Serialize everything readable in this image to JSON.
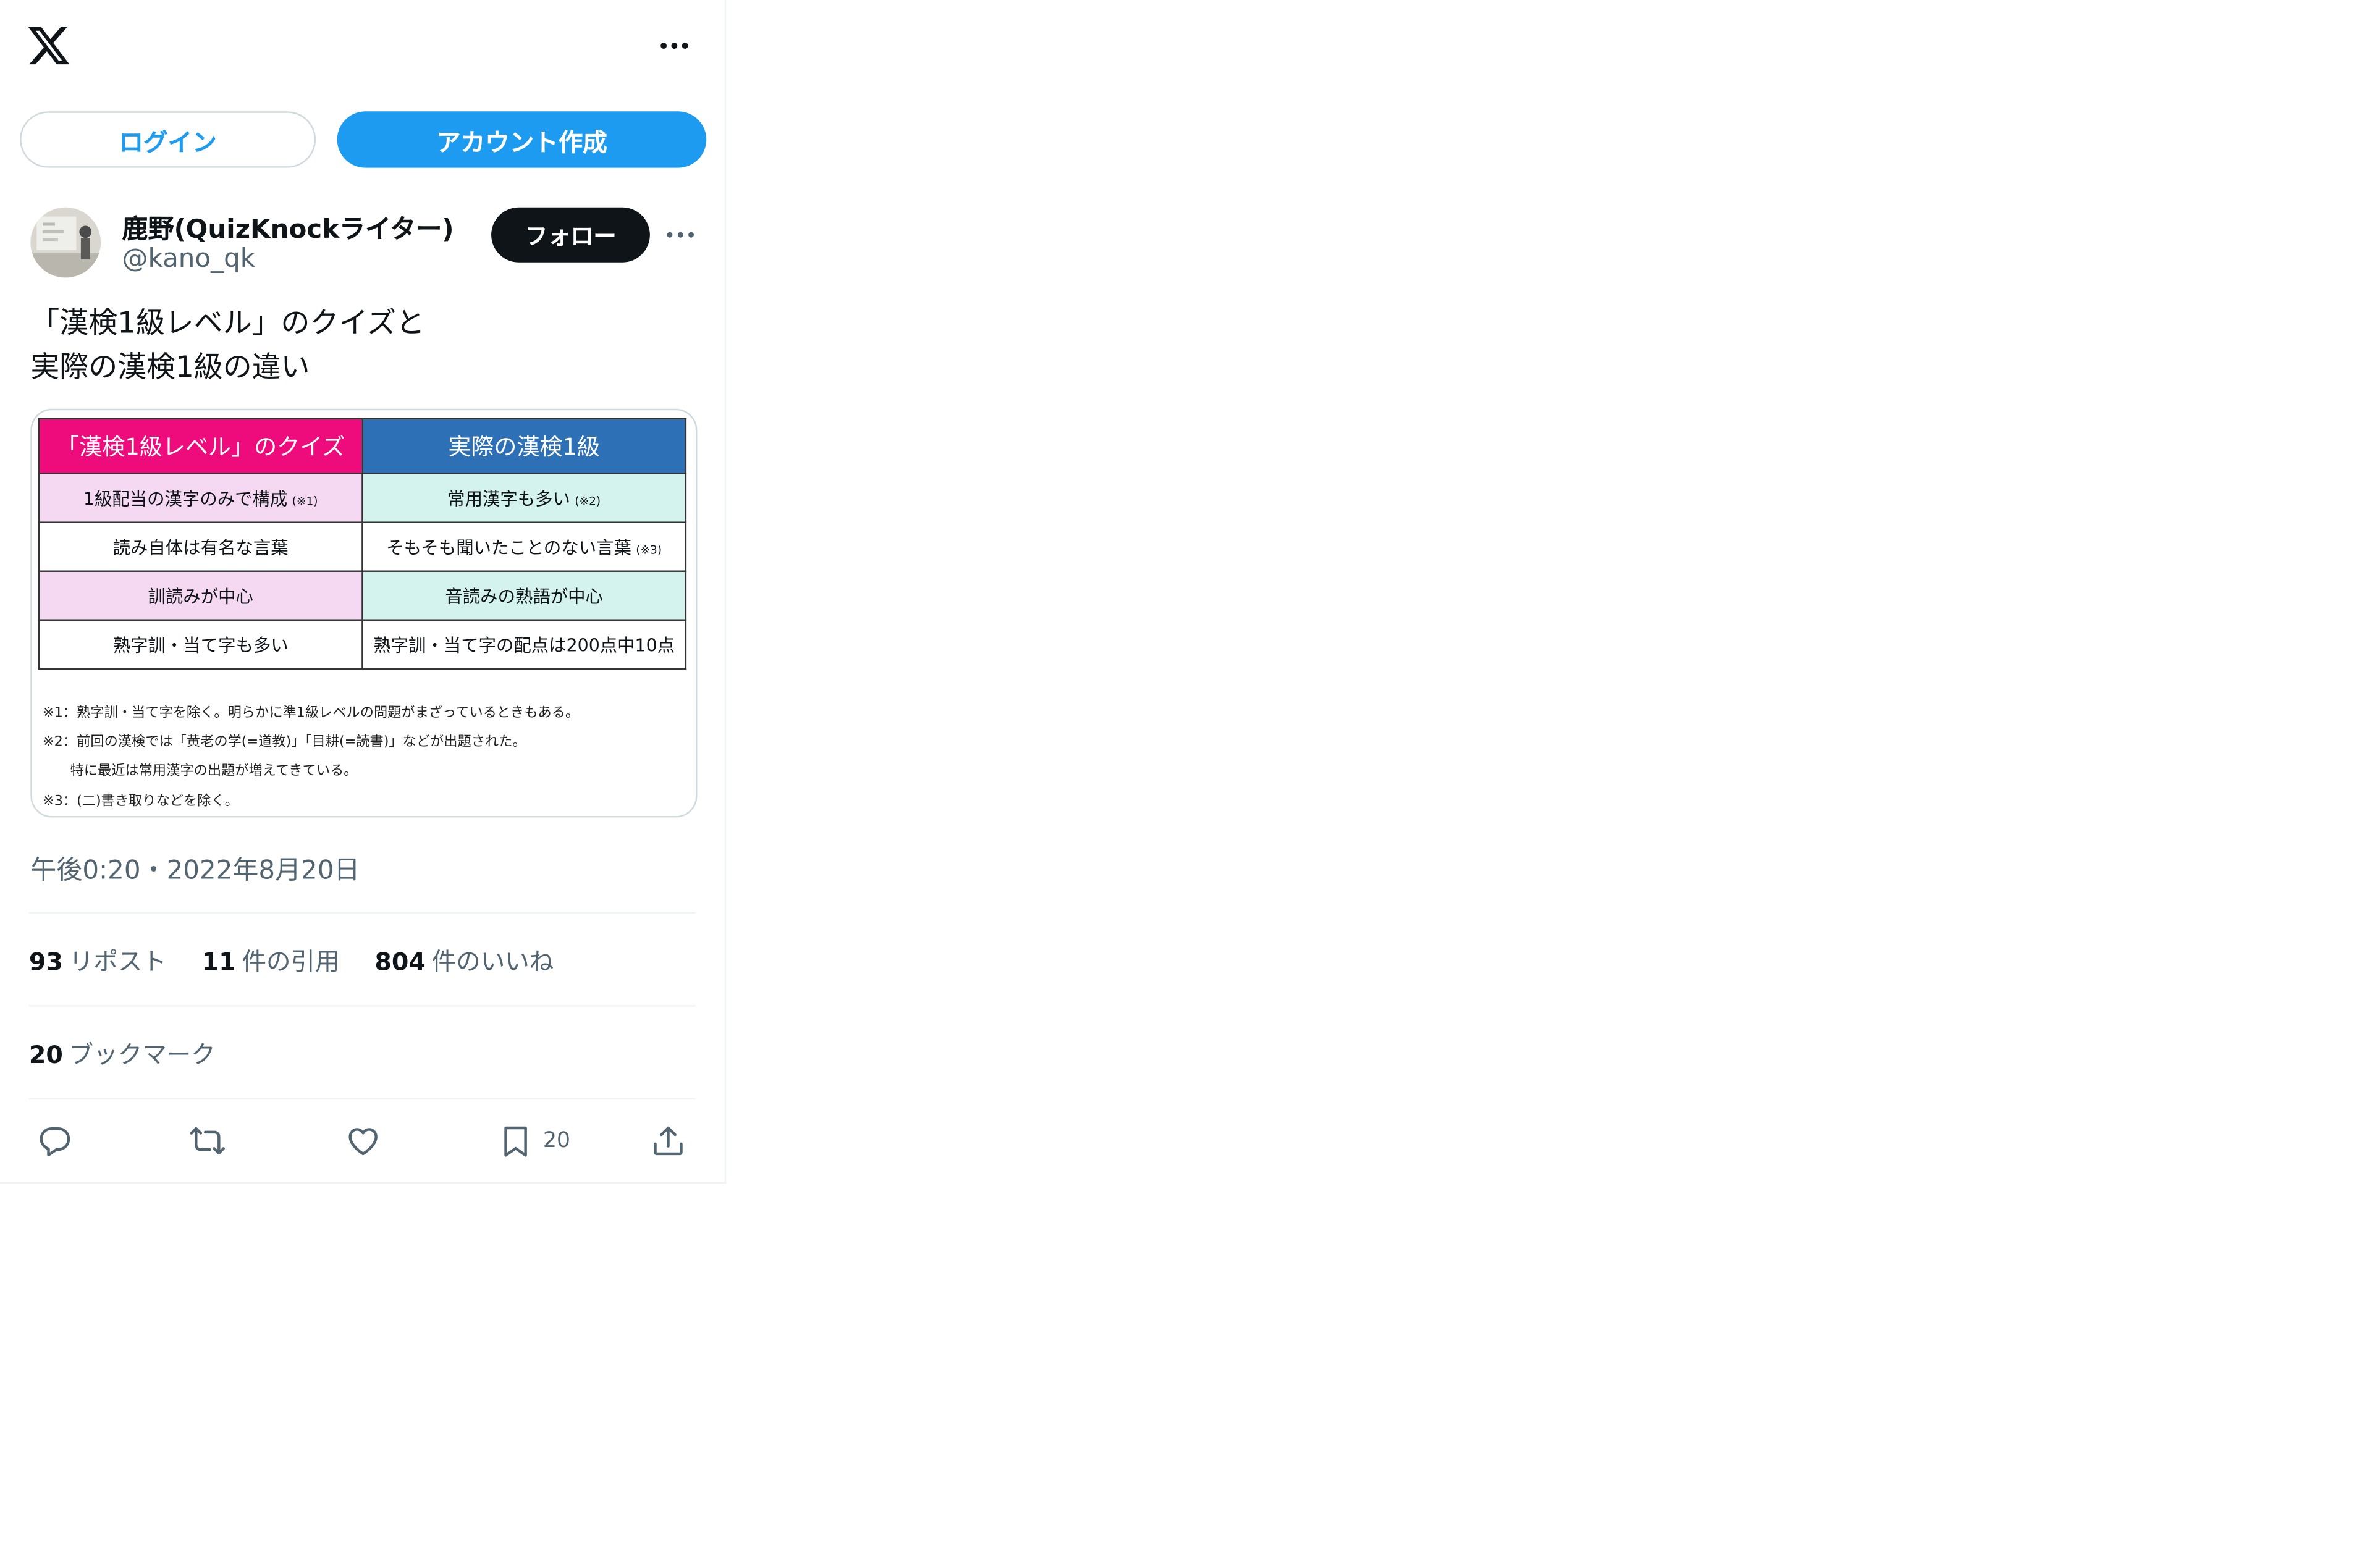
{
  "header": {
    "logo_icon": "x-logo-icon",
    "more_icon": "more-horizontal-icon"
  },
  "auth": {
    "login_label": "ログイン",
    "signup_label": "アカウント作成"
  },
  "author": {
    "display_name": "鹿野(QuizKnockライター)",
    "handle": "@kano_qk",
    "follow_label": "フォロー"
  },
  "post": {
    "text_line1": "「漢検1級レベル」のクイズと",
    "text_line2": "実際の漢検1級の違い",
    "timestamp": "午後0:20・2022年8月20日"
  },
  "media": {
    "table": {
      "header_left": "「漢検1級レベル」のクイズ",
      "header_right": "実際の漢検1級",
      "rows": [
        {
          "left": "1級配当の漢字のみで構成",
          "left_note": "(※1)",
          "right": "常用漢字も多い",
          "right_note": "(※2)"
        },
        {
          "left": "読み自体は有名な言葉",
          "left_note": "",
          "right": "そもそも聞いたことのない言葉",
          "right_note": "(※3)"
        },
        {
          "left": "訓読みが中心",
          "left_note": "",
          "right": "音読みの熟語が中心",
          "right_note": ""
        },
        {
          "left": "熟字訓・当て字も多い",
          "left_note": "",
          "right": "熟字訓・当て字の配点は200点中10点",
          "right_note": ""
        }
      ]
    },
    "notes": [
      "※1：熟字訓・当て字を除く。明らかに準1級レベルの問題がまざっているときもある。",
      "※2：前回の漢検では「黄老の学(=道教)」「目耕(=読書)」などが出題された。",
      "　　特に最近は常用漢字の出題が増えてきている。",
      "※3：(二)書き取りなどを除く。"
    ]
  },
  "stats": {
    "reposts_count": "93",
    "reposts_label": "リポスト",
    "quotes_count": "11",
    "quotes_label": "件の引用",
    "likes_count": "804",
    "likes_label": "件のいいね",
    "bookmarks_count": "20",
    "bookmarks_label": "ブックマーク"
  },
  "actions": {
    "reply_icon": "reply-icon",
    "repost_icon": "repost-icon",
    "like_icon": "heart-icon",
    "bookmark_icon": "bookmark-icon",
    "bookmark_count": "20",
    "share_icon": "share-icon"
  },
  "colors": {
    "brand_blue": "#1d9bf0",
    "text_primary": "#0f1419",
    "text_secondary": "#536471",
    "table_header_left": "#ee0b7b",
    "table_header_right": "#2e70b5",
    "table_pink": "#f5d8f1",
    "table_mint": "#d4f3ee"
  }
}
